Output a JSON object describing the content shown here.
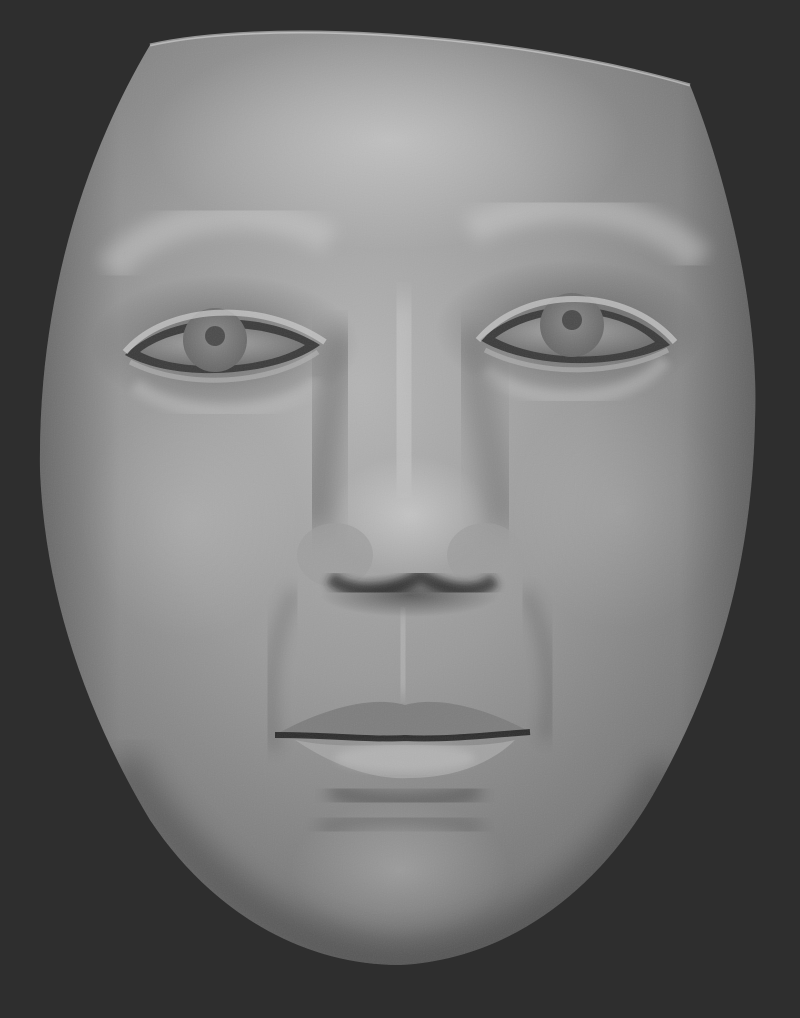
{
  "scene": {
    "subject": "sculpted-face-mesh",
    "material": "matte-clay",
    "colors": {
      "background": "#2e2e2e",
      "clay_base": "#8e8e8e",
      "clay_highlight": "#c9c9c9",
      "clay_shadow": "#3c3c3c",
      "iris": "#777777",
      "pupil": "#4a4a4a"
    }
  }
}
